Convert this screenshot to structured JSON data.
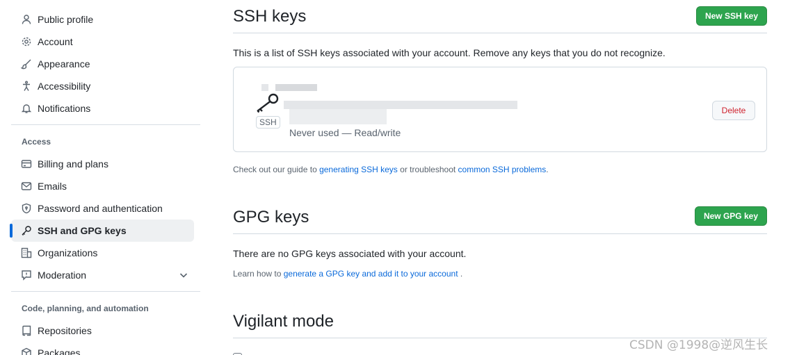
{
  "sidebar": {
    "items_top": [
      {
        "label": "Public profile",
        "icon": "person-icon"
      },
      {
        "label": "Account",
        "icon": "gear-icon"
      },
      {
        "label": "Appearance",
        "icon": "paintbrush-icon"
      },
      {
        "label": "Accessibility",
        "icon": "accessibility-icon"
      },
      {
        "label": "Notifications",
        "icon": "bell-icon"
      }
    ],
    "access_heading": "Access",
    "items_access": [
      {
        "label": "Billing and plans",
        "icon": "credit-card-icon"
      },
      {
        "label": "Emails",
        "icon": "mail-icon"
      },
      {
        "label": "Password and authentication",
        "icon": "shield-lock-icon"
      },
      {
        "label": "SSH and GPG keys",
        "icon": "key-icon",
        "active": true
      },
      {
        "label": "Organizations",
        "icon": "organization-icon"
      },
      {
        "label": "Moderation",
        "icon": "report-icon"
      }
    ],
    "automation_heading": "Code, planning, and automation",
    "items_automation": [
      {
        "label": "Repositories",
        "icon": "repo-icon"
      },
      {
        "label": "Packages",
        "icon": "package-icon"
      }
    ]
  },
  "ssh": {
    "title": "SSH keys",
    "new_button": "New SSH key",
    "description": "This is a list of SSH keys associated with your account. Remove any keys that you do not recognize.",
    "key": {
      "badge": "SSH",
      "meta": "Never used — Read/write",
      "delete_button": "Delete"
    },
    "guide_prefix": "Check out our guide to ",
    "guide_link1": "generating SSH keys",
    "guide_middle": " or troubleshoot ",
    "guide_link2": "common SSH problems",
    "guide_suffix": "."
  },
  "gpg": {
    "title": "GPG keys",
    "new_button": "New GPG key",
    "empty_text": "There are no GPG keys associated with your account.",
    "learn_prefix": "Learn how to ",
    "learn_link": "generate a GPG key and add it to your account",
    "learn_suffix": " ."
  },
  "vigilant": {
    "title": "Vigilant mode"
  },
  "watermark": "CSDN @1998@逆风生长",
  "colors": {
    "accent": "#0969da",
    "primary_button": "#2da44e",
    "danger": "#cf222e"
  }
}
